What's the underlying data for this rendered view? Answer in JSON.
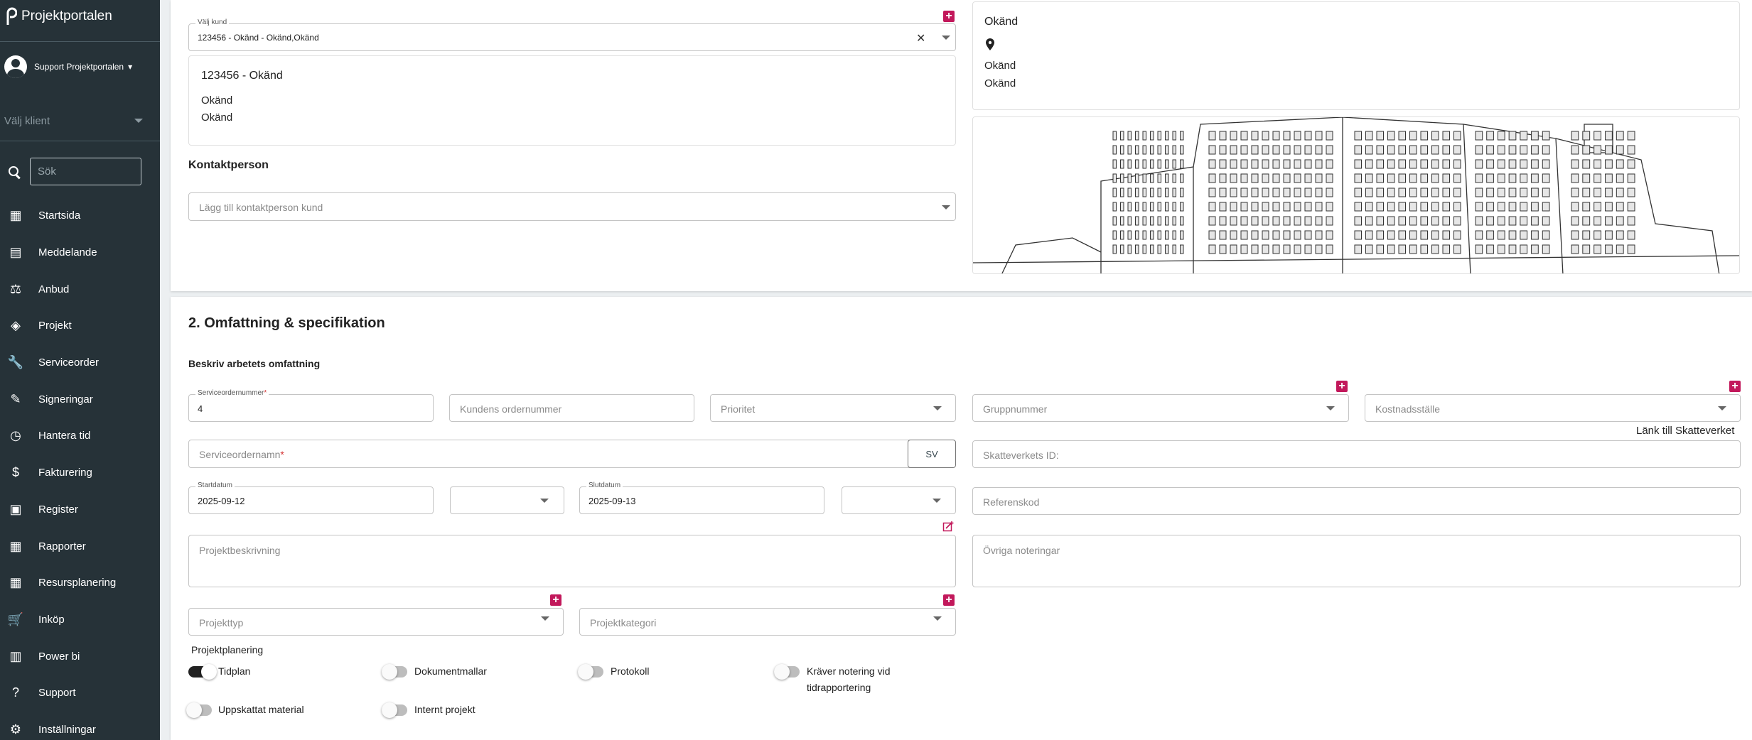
{
  "app": {
    "title": "Projektportalen"
  },
  "user": {
    "name": "Support Projektportalen"
  },
  "client_select": {
    "placeholder": "Välj klient"
  },
  "search": {
    "placeholder": "Sök"
  },
  "nav": [
    {
      "label": "Startsida",
      "icon": "dashboard-icon",
      "glyph": "▦"
    },
    {
      "label": "Meddelande",
      "icon": "message-icon",
      "glyph": "▤"
    },
    {
      "label": "Anbud",
      "icon": "gavel-icon",
      "glyph": "⚖"
    },
    {
      "label": "Projekt",
      "icon": "widgets-icon",
      "glyph": "◈"
    },
    {
      "label": "Serviceorder",
      "icon": "wrench-icon",
      "glyph": "🔧"
    },
    {
      "label": "Signeringar",
      "icon": "signature-icon",
      "glyph": "✎"
    },
    {
      "label": "Hantera tid",
      "icon": "clock-icon",
      "glyph": "◷"
    },
    {
      "label": "Fakturering",
      "icon": "dollar-icon",
      "glyph": "$"
    },
    {
      "label": "Register",
      "icon": "image-icon",
      "glyph": "▣"
    },
    {
      "label": "Rapporter",
      "icon": "calendar-icon",
      "glyph": "▦"
    },
    {
      "label": "Resursplanering",
      "icon": "calendar-month-icon",
      "glyph": "▦"
    },
    {
      "label": "Inköp",
      "icon": "cart-icon",
      "glyph": "🛒"
    },
    {
      "label": "Power bi",
      "icon": "bar-chart-icon",
      "glyph": "▥"
    },
    {
      "label": "Support",
      "icon": "help-icon",
      "glyph": "?"
    },
    {
      "label": "Inställningar",
      "icon": "gear-icon",
      "glyph": "⚙"
    }
  ],
  "customer": {
    "select_label": "Välj kund",
    "select_value": "123456 - Okänd - Okänd,Okänd",
    "info_title": "123456 - Okänd",
    "info_line1": "Okänd",
    "info_line2": "Okänd",
    "address_name": "Okänd",
    "address_line1": "Okänd",
    "address_line2": "Okänd"
  },
  "contact": {
    "heading": "Kontaktperson",
    "placeholder": "Lägg till kontaktperson kund"
  },
  "section2": {
    "title": "2. Omfattning & specifikation",
    "subtitle": "Beskriv arbetets omfattning"
  },
  "form": {
    "serviceorder_number_label": "Serviceordernummer",
    "serviceorder_number_value": "4",
    "customer_order_placeholder": "Kundens ordernummer",
    "priority_placeholder": "Prioritet",
    "group_number_placeholder": "Gruppnummer",
    "cost_center_placeholder": "Kostnadsställe",
    "tax_agency_link": "Länk till Skatteverket",
    "serviceorder_name_placeholder": "Serviceordernamn",
    "language_button": "SV",
    "tax_agency_id_placeholder": "Skatteverkets ID:",
    "start_date_label": "Startdatum",
    "start_date_value": "2025-09-12",
    "end_date_label": "Slutdatum",
    "end_date_value": "2025-09-13",
    "reference_placeholder": "Referenskod",
    "project_description_placeholder": "Projektbeskrivning",
    "other_notes_placeholder": "Övriga noteringar",
    "project_type_placeholder": "Projekttyp",
    "project_category_placeholder": "Projektkategori",
    "planning_heading": "Projektplanering"
  },
  "toggles": [
    {
      "label": "Tidplan",
      "on": true
    },
    {
      "label": "Dokumentmallar",
      "on": false
    },
    {
      "label": "Protokoll",
      "on": false
    },
    {
      "label": "Kräver notering vid tidrapportering",
      "on": false
    },
    {
      "label": "Uppskattat material",
      "on": false
    },
    {
      "label": "Internt projekt",
      "on": false
    }
  ],
  "colors": {
    "sidebar": "#263238",
    "accent": "#c2185b"
  }
}
